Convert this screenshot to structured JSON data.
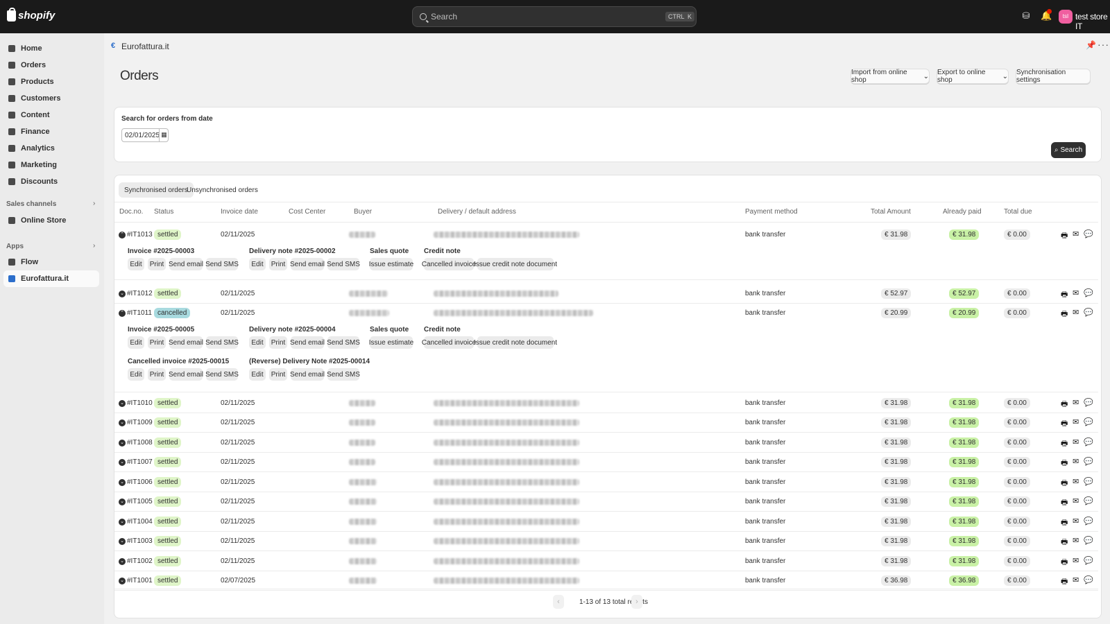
{
  "topbar": {
    "brand": "shopify",
    "search_placeholder": "Search",
    "shortcut_ctrl": "CTRL",
    "shortcut_key": "K",
    "avatar_initials": "tsI",
    "store_name": "test store IT"
  },
  "sidebar": {
    "items": [
      "Home",
      "Orders",
      "Products",
      "Customers",
      "Content",
      "Finance",
      "Analytics",
      "Marketing",
      "Discounts"
    ],
    "sales_channels_label": "Sales channels",
    "online_store": "Online Store",
    "apps_label": "Apps",
    "flow": "Flow",
    "eurofattura": "Eurofattura.it"
  },
  "appbar": {
    "name": "Eurofattura.it"
  },
  "page": {
    "title": "Orders",
    "import_btn": "Import from online shop",
    "export_btn": "Export to online shop",
    "sync_btn": "Synchronisation settings"
  },
  "filter": {
    "label": "Search for orders from date",
    "date_value": "02/01/2025",
    "search_btn": "Search"
  },
  "tabs": {
    "synced": "Synchronised orders",
    "unsynced": "Unsynchronised orders"
  },
  "columns": {
    "docno": "Doc.no.",
    "status": "Status",
    "invoice_date": "Invoice date",
    "cost_center": "Cost Center",
    "buyer": "Buyer",
    "delivery": "Delivery / default address",
    "payment": "Payment method",
    "total": "Total Amount",
    "paid": "Already paid",
    "due": "Total due"
  },
  "detail_labels": {
    "edit": "Edit",
    "print": "Print",
    "send_email": "Send email",
    "send_sms": "Send SMS",
    "sales_quote": "Sales quote",
    "issue_estimate": "Issue estimate",
    "credit_note": "Credit note",
    "cancelled_invoice": "Cancelled invoice",
    "issue_credit_note": "Issue credit note document"
  },
  "details": {
    "r1013": {
      "invoice": "Invoice #2025-00003",
      "delivery": "Delivery note #2025-00002"
    },
    "r1011": {
      "invoice": "Invoice #2025-00005",
      "delivery": "Delivery note #2025-00004",
      "cancelled": "Cancelled invoice #2025-00015",
      "reverse": "(Reverse) Delivery Note #2025-00014"
    }
  },
  "orders": [
    {
      "doc": "#IT1013",
      "status": "settled",
      "date": "02/11/2025",
      "payment": "bank transfer",
      "total": "€ 31.98",
      "paid": "€ 31.98",
      "due": "€ 0.00"
    },
    {
      "doc": "#IT1012",
      "status": "settled",
      "date": "02/11/2025",
      "payment": "bank transfer",
      "total": "€ 52.97",
      "paid": "€ 52.97",
      "due": "€ 0.00"
    },
    {
      "doc": "#IT1011",
      "status": "cancelled",
      "date": "02/11/2025",
      "payment": "bank transfer",
      "total": "€ 20.99",
      "paid": "€ 20.99",
      "due": "€ 0.00"
    },
    {
      "doc": "#IT1010",
      "status": "settled",
      "date": "02/11/2025",
      "payment": "bank transfer",
      "total": "€ 31.98",
      "paid": "€ 31.98",
      "due": "€ 0.00"
    },
    {
      "doc": "#IT1009",
      "status": "settled",
      "date": "02/11/2025",
      "payment": "bank transfer",
      "total": "€ 31.98",
      "paid": "€ 31.98",
      "due": "€ 0.00"
    },
    {
      "doc": "#IT1008",
      "status": "settled",
      "date": "02/11/2025",
      "payment": "bank transfer",
      "total": "€ 31.98",
      "paid": "€ 31.98",
      "due": "€ 0.00"
    },
    {
      "doc": "#IT1007",
      "status": "settled",
      "date": "02/11/2025",
      "payment": "bank transfer",
      "total": "€ 31.98",
      "paid": "€ 31.98",
      "due": "€ 0.00"
    },
    {
      "doc": "#IT1006",
      "status": "settled",
      "date": "02/11/2025",
      "payment": "bank transfer",
      "total": "€ 31.98",
      "paid": "€ 31.98",
      "due": "€ 0.00"
    },
    {
      "doc": "#IT1005",
      "status": "settled",
      "date": "02/11/2025",
      "payment": "bank transfer",
      "total": "€ 31.98",
      "paid": "€ 31.98",
      "due": "€ 0.00"
    },
    {
      "doc": "#IT1004",
      "status": "settled",
      "date": "02/11/2025",
      "payment": "bank transfer",
      "total": "€ 31.98",
      "paid": "€ 31.98",
      "due": "€ 0.00"
    },
    {
      "doc": "#IT1003",
      "status": "settled",
      "date": "02/11/2025",
      "payment": "bank transfer",
      "total": "€ 31.98",
      "paid": "€ 31.98",
      "due": "€ 0.00"
    },
    {
      "doc": "#IT1002",
      "status": "settled",
      "date": "02/11/2025",
      "payment": "bank transfer",
      "total": "€ 31.98",
      "paid": "€ 31.98",
      "due": "€ 0.00"
    },
    {
      "doc": "#IT1001",
      "status": "settled",
      "date": "02/07/2025",
      "payment": "bank transfer",
      "total": "€ 36.98",
      "paid": "€ 36.98",
      "due": "€ 0.00"
    }
  ],
  "pagination": {
    "text": "1-13 of 13 total results"
  },
  "icons": {
    "print": "print-icon",
    "email": "email-icon",
    "sms": "chat-icon"
  },
  "colors": {
    "topbar": "#1a1a1a",
    "settled": "#dff5c8",
    "cancelled": "#a8dadf",
    "paid": "#c9f1a6"
  }
}
